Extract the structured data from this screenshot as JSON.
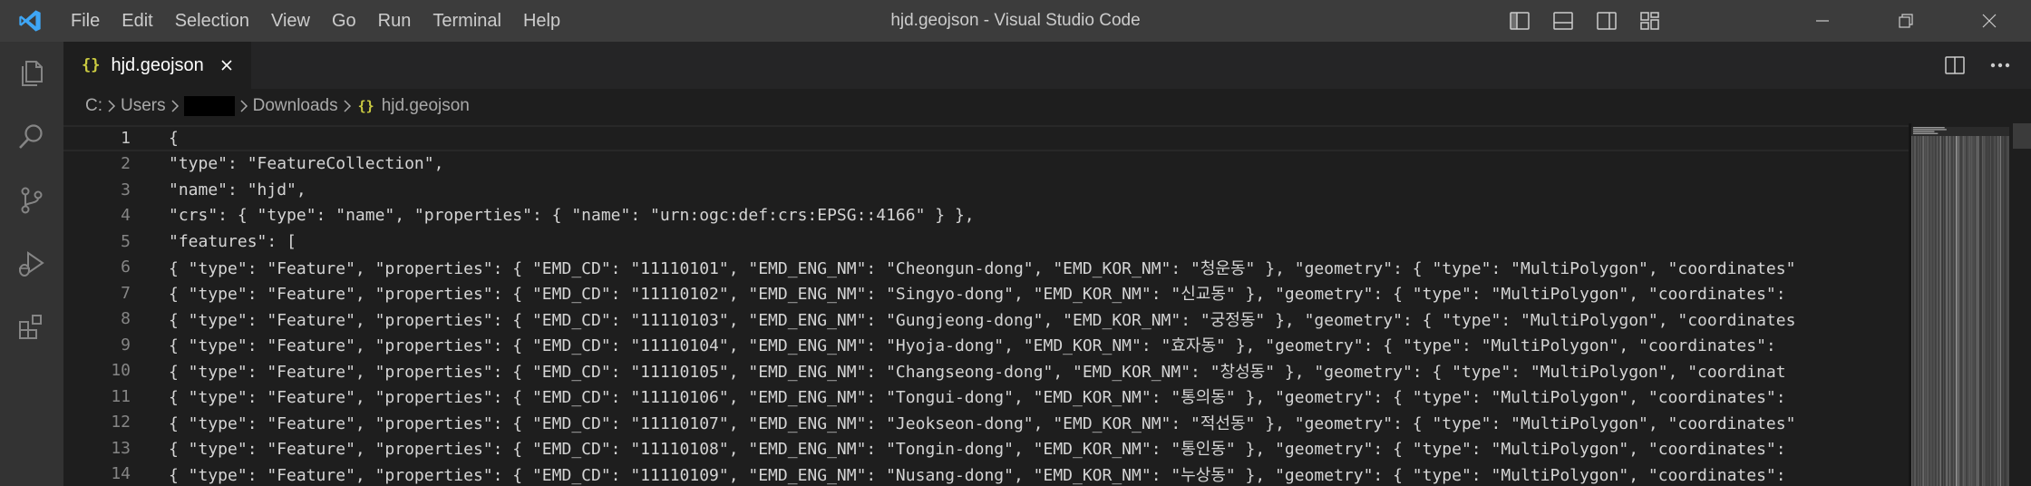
{
  "window": {
    "title": "hjd.geojson - Visual Studio Code"
  },
  "menu": [
    "File",
    "Edit",
    "Selection",
    "View",
    "Go",
    "Run",
    "Terminal",
    "Help"
  ],
  "tab": {
    "label": "hjd.geojson",
    "icon": "{}"
  },
  "breadcrumb": [
    "C:",
    "Users",
    "Downloads",
    "hjd.geojson"
  ],
  "editor": {
    "lines": [
      {
        "n": "1",
        "text": "{"
      },
      {
        "n": "2",
        "text": "\"type\": \"FeatureCollection\","
      },
      {
        "n": "3",
        "text": "\"name\": \"hjd\","
      },
      {
        "n": "4",
        "text": "\"crs\": { \"type\": \"name\", \"properties\": { \"name\": \"urn:ogc:def:crs:EPSG::4166\" } },"
      },
      {
        "n": "5",
        "text": "\"features\": ["
      },
      {
        "n": "6",
        "text": "{ \"type\": \"Feature\", \"properties\": { \"EMD_CD\": \"11110101\", \"EMD_ENG_NM\": \"Cheongun-dong\", \"EMD_KOR_NM\": \"청운동\" }, \"geometry\": { \"type\": \"MultiPolygon\", \"coordinates\""
      },
      {
        "n": "7",
        "text": "{ \"type\": \"Feature\", \"properties\": { \"EMD_CD\": \"11110102\", \"EMD_ENG_NM\": \"Singyo-dong\", \"EMD_KOR_NM\": \"신교동\" }, \"geometry\": { \"type\": \"MultiPolygon\", \"coordinates\":"
      },
      {
        "n": "8",
        "text": "{ \"type\": \"Feature\", \"properties\": { \"EMD_CD\": \"11110103\", \"EMD_ENG_NM\": \"Gungjeong-dong\", \"EMD_KOR_NM\": \"궁정동\" }, \"geometry\": { \"type\": \"MultiPolygon\", \"coordinates"
      },
      {
        "n": "9",
        "text": "{ \"type\": \"Feature\", \"properties\": { \"EMD_CD\": \"11110104\", \"EMD_ENG_NM\": \"Hyoja-dong\", \"EMD_KOR_NM\": \"효자동\" }, \"geometry\": { \"type\": \"MultiPolygon\", \"coordinates\":"
      },
      {
        "n": "10",
        "text": "{ \"type\": \"Feature\", \"properties\": { \"EMD_CD\": \"11110105\", \"EMD_ENG_NM\": \"Changseong-dong\", \"EMD_KOR_NM\": \"창성동\" }, \"geometry\": { \"type\": \"MultiPolygon\", \"coordinat"
      },
      {
        "n": "11",
        "text": "{ \"type\": \"Feature\", \"properties\": { \"EMD_CD\": \"11110106\", \"EMD_ENG_NM\": \"Tongui-dong\", \"EMD_KOR_NM\": \"통의동\" }, \"geometry\": { \"type\": \"MultiPolygon\", \"coordinates\":"
      },
      {
        "n": "12",
        "text": "{ \"type\": \"Feature\", \"properties\": { \"EMD_CD\": \"11110107\", \"EMD_ENG_NM\": \"Jeokseon-dong\", \"EMD_KOR_NM\": \"적선동\" }, \"geometry\": { \"type\": \"MultiPolygon\", \"coordinates\""
      },
      {
        "n": "13",
        "text": "{ \"type\": \"Feature\", \"properties\": { \"EMD_CD\": \"11110108\", \"EMD_ENG_NM\": \"Tongin-dong\", \"EMD_KOR_NM\": \"통인동\" }, \"geometry\": { \"type\": \"MultiPolygon\", \"coordinates\":"
      },
      {
        "n": "14",
        "text": "{ \"type\": \"Feature\", \"properties\": { \"EMD_CD\": \"11110109\", \"EMD_ENG_NM\": \"Nusang-dong\", \"EMD_KOR_NM\": \"누상동\" }, \"geometry\": { \"type\": \"MultiPolygon\", \"coordinates\":"
      }
    ]
  },
  "colors": {
    "accent": "#0078d4",
    "title_bar": "#3c3c3c",
    "editor_bg": "#1e1e1e",
    "json_icon": "#cbcb41"
  },
  "icons": {
    "activity_bar": [
      "explorer-icon",
      "search-icon",
      "source-control-icon",
      "run-debug-icon",
      "extensions-icon"
    ],
    "layout": [
      "toggle-primary-sidebar-icon",
      "toggle-panel-icon",
      "toggle-secondary-sidebar-icon",
      "customize-layout-icon"
    ],
    "window": [
      "minimize-icon",
      "restore-icon",
      "close-icon"
    ]
  }
}
